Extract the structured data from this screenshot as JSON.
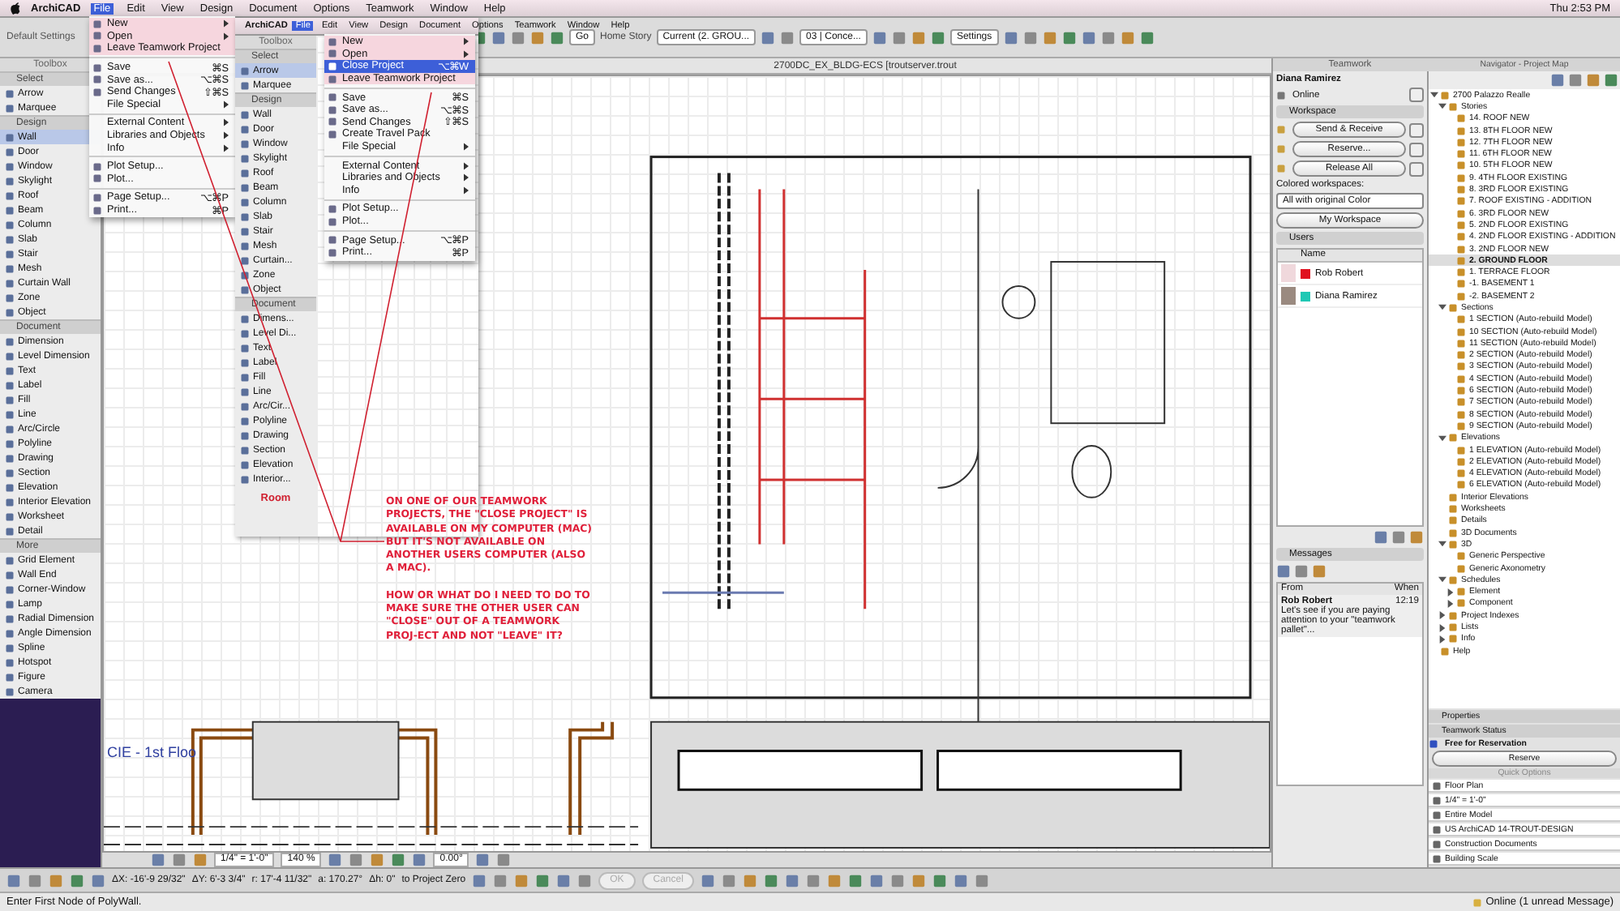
{
  "menubar": {
    "app": "ArchiCAD",
    "menus": [
      {
        "label": "File",
        "selected": true
      },
      {
        "label": "Edit",
        "selected": false
      },
      {
        "label": "View",
        "selected": false
      },
      {
        "label": "Design",
        "selected": false
      },
      {
        "label": "Document",
        "selected": false
      },
      {
        "label": "Options",
        "selected": false
      },
      {
        "label": "Teamwork",
        "selected": false
      },
      {
        "label": "Window",
        "selected": false
      },
      {
        "label": "Help",
        "selected": false
      }
    ],
    "clock": "Thu 2:53 PM"
  },
  "toolbar": {
    "default_settings": "Default Settings",
    "go": "Go",
    "home_story_label": "Home Story",
    "home_story": "Current (2. GROU...",
    "layer": "03 | Conce...",
    "settings": "Settings"
  },
  "toolbox": {
    "title": "Toolbox",
    "groups": [
      {
        "title": "Select",
        "items": [
          {
            "label": "Arrow",
            "selected": false
          },
          {
            "label": "Marquee",
            "selected": false
          }
        ]
      },
      {
        "title": "Design",
        "items": [
          {
            "label": "Wall",
            "selected": true
          },
          {
            "label": "Door",
            "selected": false
          },
          {
            "label": "Window",
            "selected": false
          },
          {
            "label": "Skylight",
            "selected": false
          },
          {
            "label": "Roof",
            "selected": false
          },
          {
            "label": "Beam",
            "selected": false
          },
          {
            "label": "Column",
            "selected": false
          },
          {
            "label": "Slab",
            "selected": false
          },
          {
            "label": "Stair",
            "selected": false
          },
          {
            "label": "Mesh",
            "selected": false
          },
          {
            "label": "Curtain Wall",
            "selected": false
          },
          {
            "label": "Zone",
            "selected": false
          },
          {
            "label": "Object",
            "selected": false
          }
        ]
      },
      {
        "title": "Document",
        "items": [
          {
            "label": "Dimension",
            "selected": false
          },
          {
            "label": "Level Dimension",
            "selected": false
          },
          {
            "label": "Text",
            "selected": false
          },
          {
            "label": "Label",
            "selected": false
          },
          {
            "label": "Fill",
            "selected": false
          },
          {
            "label": "Line",
            "selected": false
          },
          {
            "label": "Arc/Circle",
            "selected": false
          },
          {
            "label": "Polyline",
            "selected": false
          },
          {
            "label": "Drawing",
            "selected": false
          },
          {
            "label": "Section",
            "selected": false
          },
          {
            "label": "Elevation",
            "selected": false
          },
          {
            "label": "Interior Elevation",
            "selected": false
          },
          {
            "label": "Worksheet",
            "selected": false
          },
          {
            "label": "Detail",
            "selected": false
          }
        ]
      },
      {
        "title": "More",
        "items": [
          {
            "label": "Grid Element",
            "selected": false
          },
          {
            "label": "Wall End",
            "selected": false
          },
          {
            "label": "Corner-Window",
            "selected": false
          },
          {
            "label": "Lamp",
            "selected": false
          },
          {
            "label": "Radial Dimension",
            "selected": false
          },
          {
            "label": "Angle Dimension",
            "selected": false
          },
          {
            "label": "Spline",
            "selected": false
          },
          {
            "label": "Hotspot",
            "selected": false
          },
          {
            "label": "Figure",
            "selected": false
          },
          {
            "label": "Camera",
            "selected": false
          }
        ]
      }
    ]
  },
  "file_menu": {
    "items": [
      {
        "kind": "item",
        "label": "New",
        "icon": true,
        "submenu": true,
        "selected": false,
        "highlighted": true
      },
      {
        "kind": "item",
        "label": "Open",
        "icon": true,
        "submenu": true,
        "selected": false,
        "highlighted": true
      },
      {
        "kind": "item",
        "label": "Leave Teamwork Project",
        "icon": true,
        "submenu": false,
        "selected": false,
        "highlighted": true
      },
      {
        "kind": "separator"
      },
      {
        "kind": "item",
        "label": "Save",
        "icon": true,
        "shortcut": "⌘S",
        "submenu": false,
        "selected": false,
        "highlighted": false
      },
      {
        "kind": "item",
        "label": "Save as...",
        "icon": true,
        "shortcut": "⌥⌘S",
        "submenu": false,
        "selected": false,
        "highlighted": false
      },
      {
        "kind": "item",
        "label": "Send Changes",
        "icon": true,
        "shortcut": "⇧⌘S",
        "submenu": false,
        "selected": false,
        "highlighted": false
      },
      {
        "kind": "item",
        "label": "File Special",
        "icon": false,
        "submenu": true,
        "selected": false,
        "highlighted": false
      },
      {
        "kind": "separator"
      },
      {
        "kind": "item",
        "label": "External Content",
        "icon": false,
        "submenu": true,
        "selected": false,
        "highlighted": false
      },
      {
        "kind": "item",
        "label": "Libraries and Objects",
        "icon": false,
        "submenu": true,
        "selected": false,
        "highlighted": false
      },
      {
        "kind": "item",
        "label": "Info",
        "icon": false,
        "submenu": true,
        "selected": false,
        "highlighted": false
      },
      {
        "kind": "separator"
      },
      {
        "kind": "item",
        "label": "Plot Setup...",
        "icon": true,
        "submenu": false,
        "selected": false,
        "highlighted": false
      },
      {
        "kind": "item",
        "label": "Plot...",
        "icon": true,
        "submenu": false,
        "selected": false,
        "highlighted": false
      },
      {
        "kind": "separator"
      },
      {
        "kind": "item",
        "label": "Page Setup...",
        "icon": true,
        "shortcut": "⌥⌘P",
        "submenu": false,
        "selected": false,
        "highlighted": false
      },
      {
        "kind": "item",
        "label": "Print...",
        "icon": true,
        "shortcut": "⌘P",
        "submenu": false,
        "selected": false,
        "highlighted": false
      }
    ]
  },
  "inset_window": {
    "menubar": {
      "app": "ArchiCAD",
      "menus": [
        {
          "label": "File",
          "selected": true
        },
        {
          "label": "Edit",
          "selected": false
        },
        {
          "label": "View",
          "selected": false
        },
        {
          "label": "Design",
          "selected": false
        },
        {
          "label": "Document",
          "selected": false
        },
        {
          "label": "Options",
          "selected": false
        },
        {
          "label": "Teamwork",
          "selected": false
        },
        {
          "label": "Window",
          "selected": false
        },
        {
          "label": "Help",
          "selected": false
        }
      ]
    },
    "toolbox": {
      "title": "Toolbox",
      "groups": [
        {
          "title": "Select",
          "items": [
            {
              "label": "Arrow",
              "selected": true
            },
            {
              "label": "Marquee",
              "selected": false
            }
          ]
        },
        {
          "title": "Design",
          "items": [
            {
              "label": "Wall",
              "selected": false
            },
            {
              "label": "Door",
              "selected": false
            },
            {
              "label": "Window",
              "selected": false
            },
            {
              "label": "Skylight",
              "selected": false
            },
            {
              "label": "Roof",
              "selected": false
            },
            {
              "label": "Beam",
              "selected": false
            },
            {
              "label": "Column",
              "selected": false
            },
            {
              "label": "Slab",
              "selected": false
            },
            {
              "label": "Stair",
              "selected": false
            },
            {
              "label": "Mesh",
              "selected": false
            },
            {
              "label": "Curtain...",
              "selected": false
            },
            {
              "label": "Zone",
              "selected": false
            },
            {
              "label": "Object",
              "selected": false
            }
          ]
        },
        {
          "title": "Document",
          "items": [
            {
              "label": "Dimens...",
              "selected": false
            },
            {
              "label": "Level Di...",
              "selected": false
            },
            {
              "label": "Text",
              "selected": false
            },
            {
              "label": "Label",
              "selected": false
            },
            {
              "label": "Fill",
              "selected": false
            },
            {
              "label": "Line",
              "selected": false
            },
            {
              "label": "Arc/Cir...",
              "selected": false
            },
            {
              "label": "Polyline",
              "selected": false
            },
            {
              "label": "Drawing",
              "selected": false
            },
            {
              "label": "Section",
              "selected": false
            },
            {
              "label": "Elevation",
              "selected": false
            },
            {
              "label": "Interior...",
              "selected": false
            }
          ]
        }
      ]
    },
    "room_label": "Room",
    "file_menu": {
      "items": [
        {
          "kind": "item",
          "label": "New",
          "icon": true,
          "submenu": true,
          "selected": false,
          "highlighted": true
        },
        {
          "kind": "item",
          "label": "Open",
          "icon": true,
          "submenu": true,
          "selected": false,
          "highlighted": true
        },
        {
          "kind": "item",
          "label": "Close Project",
          "icon": true,
          "shortcut": "⌥⌘W",
          "submenu": false,
          "selected": true,
          "highlighted": false
        },
        {
          "kind": "item",
          "label": "Leave Teamwork Project",
          "icon": true,
          "submenu": false,
          "selected": false,
          "highlighted": true
        },
        {
          "kind": "separator"
        },
        {
          "kind": "item",
          "label": "Save",
          "icon": true,
          "shortcut": "⌘S",
          "submenu": false,
          "selected": false,
          "highlighted": false
        },
        {
          "kind": "item",
          "label": "Save as...",
          "icon": true,
          "shortcut": "⌥⌘S",
          "submenu": false,
          "selected": false,
          "highlighted": false
        },
        {
          "kind": "item",
          "label": "Send Changes",
          "icon": true,
          "shortcut": "⇧⌘S",
          "submenu": false,
          "selected": false,
          "highlighted": false
        },
        {
          "kind": "item",
          "label": "Create Travel Pack",
          "icon": true,
          "submenu": false,
          "selected": false,
          "highlighted": false
        },
        {
          "kind": "item",
          "label": "File Special",
          "icon": false,
          "submenu": true,
          "selected": false,
          "highlighted": false
        },
        {
          "kind": "separator"
        },
        {
          "kind": "item",
          "label": "External Content",
          "icon": false,
          "submenu": true,
          "selected": false,
          "highlighted": false
        },
        {
          "kind": "item",
          "label": "Libraries and Objects",
          "icon": false,
          "submenu": true,
          "selected": false,
          "highlighted": false
        },
        {
          "kind": "item",
          "label": "Info",
          "icon": false,
          "submenu": true,
          "selected": false,
          "highlighted": false
        },
        {
          "kind": "separator"
        },
        {
          "kind": "item",
          "label": "Plot Setup...",
          "icon": true,
          "submenu": false,
          "selected": false,
          "highlighted": false
        },
        {
          "kind": "item",
          "label": "Plot...",
          "icon": true,
          "submenu": false,
          "selected": false,
          "highlighted": false
        },
        {
          "kind": "separator"
        },
        {
          "kind": "item",
          "label": "Page Setup...",
          "icon": true,
          "shortcut": "⌥⌘P",
          "submenu": false,
          "selected": false,
          "highlighted": false
        },
        {
          "kind": "item",
          "label": "Print...",
          "icon": true,
          "shortcut": "⌘P",
          "submenu": false,
          "selected": false,
          "highlighted": false
        }
      ]
    }
  },
  "document_tab": "2700DC_EX_BLDG-ECS [troutserver.trout",
  "canvas": {
    "story_label": "CIE - 1st Floo"
  },
  "annotation": {
    "paragraphs": [
      "ON ONE OF OUR TEAMWORK PROJECTS, THE \"CLOSE PROJECT\" IS AVAILABLE ON MY COMPUTER (MAC) BUT IT'S NOT AVAILABLE ON ANOTHER USERS COMPUTER (ALSO A MAC).",
      "HOW OR WHAT DO I NEED TO DO TO MAKE SURE THE OTHER USER CAN \"CLOSE\" OUT OF A TEAMWORK PROJ-ECT AND NOT \"LEAVE\" IT?"
    ]
  },
  "view_bar": {
    "scale": "1/4\" = 1'-0\"",
    "zoom": "140 %",
    "angle": "0.00°"
  },
  "teamwork": {
    "title": "Teamwork",
    "user": "Diana Ramirez",
    "status": "Online",
    "workspace_header": "Workspace",
    "buttons": [
      "Send & Receive",
      "Reserve...",
      "Release All"
    ],
    "colored_label": "Colored workspaces:",
    "colored_value": "All with original Color",
    "my_workspace": "My Workspace",
    "users_header": "Users",
    "users_column": "Name",
    "users": [
      {
        "name": "Rob Robert",
        "color": "#e0101e"
      },
      {
        "name": "Diana Ramirez",
        "color": "#1ec8b4"
      }
    ],
    "messages_header": "Messages",
    "from_column": "From",
    "when_column": "When",
    "messages": [
      {
        "from": "Rob Robert",
        "time": "12:19",
        "text": "Let's see if you are paying attention to your \"teamwork pallet\"..."
      }
    ]
  },
  "navigator": {
    "title": "Navigator - Project Map",
    "tree": [
      {
        "label": "2700 Palazzo Realle",
        "selected": false,
        "expanded": true,
        "children": [
          {
            "label": "Stories",
            "selected": false,
            "expanded": true,
            "children": [
              {
                "label": "14. ROOF NEW",
                "selected": false
              },
              {
                "label": "13. 8TH FLOOR NEW",
                "selected": false
              },
              {
                "label": "12. 7TH FLOOR NEW",
                "selected": false
              },
              {
                "label": "11. 6TH FLOOR NEW",
                "selected": false
              },
              {
                "label": "10. 5TH FLOOR NEW",
                "selected": false
              },
              {
                "label": "9. 4TH FLOOR EXISTING",
                "selected": false
              },
              {
                "label": "8. 3RD FLOOR EXISTING",
                "selected": false
              },
              {
                "label": "7. ROOF EXISTING - ADDITION",
                "selected": false
              },
              {
                "label": "6. 3RD FLOOR NEW",
                "selected": false
              },
              {
                "label": "5. 2ND FLOOR EXISTING",
                "selected": false
              },
              {
                "label": "4. 2ND FLOOR EXISTING - ADDITION",
                "selected": false
              },
              {
                "label": "3. 2ND FLOOR NEW",
                "selected": false
              },
              {
                "label": "2. GROUND FLOOR",
                "selected": true
              },
              {
                "label": "1. TERRACE FLOOR",
                "selected": false
              },
              {
                "label": "-1. BASEMENT 1",
                "selected": false
              },
              {
                "label": "-2. BASEMENT 2",
                "selected": false
              }
            ]
          },
          {
            "label": "Sections",
            "selected": false,
            "expanded": true,
            "children": [
              {
                "label": "1 SECTION (Auto-rebuild Model)",
                "selected": false
              },
              {
                "label": "10 SECTION (Auto-rebuild Model)",
                "selected": false
              },
              {
                "label": "11 SECTION (Auto-rebuild Model)",
                "selected": false
              },
              {
                "label": "2 SECTION (Auto-rebuild Model)",
                "selected": false
              },
              {
                "label": "3 SECTION (Auto-rebuild Model)",
                "selected": false
              },
              {
                "label": "4 SECTION (Auto-rebuild Model)",
                "selected": false
              },
              {
                "label": "6 SECTION (Auto-rebuild Model)",
                "selected": false
              },
              {
                "label": "7 SECTION (Auto-rebuild Model)",
                "selected": false
              },
              {
                "label": "8 SECTION (Auto-rebuild Model)",
                "selected": false
              },
              {
                "label": "9 SECTION (Auto-rebuild Model)",
                "selected": false
              }
            ]
          },
          {
            "label": "Elevations",
            "selected": false,
            "expanded": true,
            "children": [
              {
                "label": "1 ELEVATION (Auto-rebuild Model)",
                "selected": false
              },
              {
                "label": "2 ELEVATION (Auto-rebuild Model)",
                "selected": false
              },
              {
                "label": "4 ELEVATION (Auto-rebuild Model)",
                "selected": false
              },
              {
                "label": "6 ELEVATION (Auto-rebuild Model)",
                "selected": false
              }
            ]
          },
          {
            "label": "Interior Elevations",
            "selected": false
          },
          {
            "label": "Worksheets",
            "selected": false
          },
          {
            "label": "Details",
            "selected": false
          },
          {
            "label": "3D Documents",
            "selected": false
          },
          {
            "label": "3D",
            "selected": false,
            "expanded": true,
            "children": [
              {
                "label": "Generic Perspective",
                "selected": false
              },
              {
                "label": "Generic Axonometry",
                "selected": false
              }
            ]
          },
          {
            "label": "Schedules",
            "selected": false,
            "expanded": true,
            "children": [
              {
                "label": "Element",
                "selected": false,
                "expanded": false
              },
              {
                "label": "Component",
                "selected": false,
                "expanded": false
              }
            ]
          },
          {
            "label": "Project Indexes",
            "selected": false,
            "expanded": false
          },
          {
            "label": "Lists",
            "selected": false,
            "expanded": false
          },
          {
            "label": "Info",
            "selected": false,
            "expanded": false
          }
        ]
      },
      {
        "label": "Help",
        "selected": false
      }
    ],
    "properties": "Properties",
    "teamwork_status": "Teamwork Status",
    "reservation": "Free for Reservation",
    "reserve": "Reserve",
    "quick_options": "Quick Options",
    "options": [
      "Floor Plan",
      "1/4\"   =   1'-0\"",
      "Entire Model",
      "US ArchiCAD 14-TROUT-DESIGN",
      "Construction Documents",
      "Building Scale"
    ]
  },
  "info_box": {
    "fields": [
      "ΔX: -16'-9 29/32\"",
      "ΔY: 6'-3 3/4\"",
      "r: 17'-4 11/32\"",
      "a: 170.27°",
      "Δh: 0\"",
      "to Project Zero"
    ],
    "buttons": [
      {
        "label": "OK",
        "disabled": true
      },
      {
        "label": "Cancel",
        "disabled": true
      }
    ]
  },
  "status_bar": {
    "prompt": "Enter First Node of PolyWall.",
    "online": "Online (1 unread Message)"
  }
}
